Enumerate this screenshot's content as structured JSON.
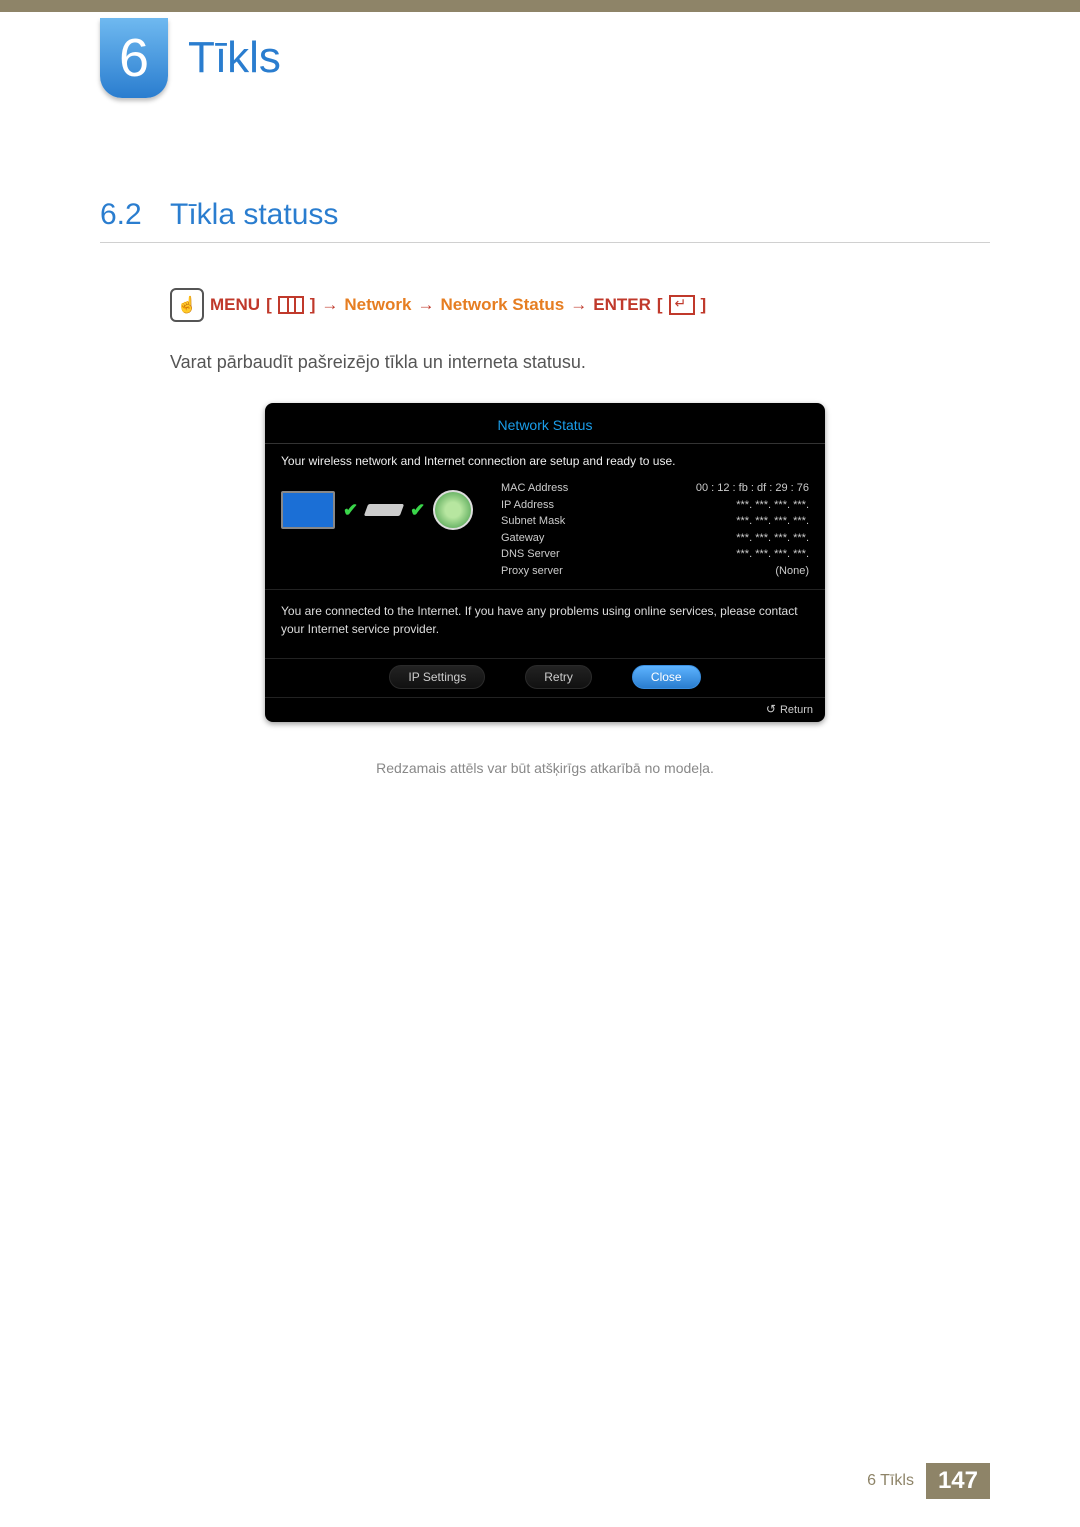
{
  "chapter": {
    "number": "6",
    "title": "Tīkls"
  },
  "section": {
    "number": "6.2",
    "title": "Tīkla statuss"
  },
  "nav": {
    "menu": "MENU",
    "network": "Network",
    "network_status": "Network Status",
    "enter": "ENTER",
    "arrow": "→"
  },
  "body_text": "Varat pārbaudīt pašreizējo tīkla un interneta statusu.",
  "panel": {
    "title": "Network Status",
    "status_msg": "Your wireless network and Internet connection are setup and ready to use.",
    "rows": [
      {
        "k": "MAC Address",
        "v": "00 : 12 : fb : df : 29 : 76"
      },
      {
        "k": "IP Address",
        "v": "***.   ***.   ***.   ***."
      },
      {
        "k": "Subnet Mask",
        "v": "***.   ***.   ***.   ***."
      },
      {
        "k": "Gateway",
        "v": "***.   ***.   ***.   ***."
      },
      {
        "k": "DNS Server",
        "v": "***.   ***.   ***.   ***."
      },
      {
        "k": "Proxy server",
        "v": "(None)"
      }
    ],
    "msg2": "You are connected to the Internet. If you have any problems using online services, please contact your Internet service provider.",
    "buttons": {
      "ip_settings": "IP Settings",
      "retry": "Retry",
      "close": "Close"
    },
    "return": "Return"
  },
  "caption": "Redzamais attēls var būt atšķirīgs atkarībā no modeļa.",
  "footer": {
    "label": "6 Tīkls",
    "page": "147"
  }
}
